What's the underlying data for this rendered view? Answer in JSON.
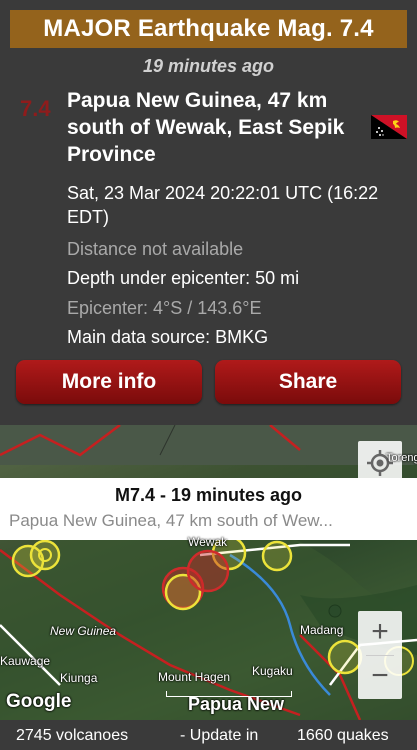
{
  "banner": {
    "title": "MAJOR Earthquake Mag. 7.4"
  },
  "time_ago": "19 minutes ago",
  "quake": {
    "magnitude": "7.4",
    "location": "Papua New Guinea, 47 km south of Wewak, East Sepik Province",
    "datetime": "Sat, 23 Mar 2024 20:22:01 UTC (16:22 EDT)",
    "distance": "Distance not available",
    "depth": "Depth under epicenter: 50 mi",
    "epicenter": "Epicenter: 4°S / 143.6°E",
    "source": "Main data source: BMKG"
  },
  "buttons": {
    "more_info": "More info",
    "share": "Share"
  },
  "map": {
    "popup_title": "M7.4  -  19 minutes ago",
    "popup_subtitle": "Papua New Guinea, 47 km south of Wew...",
    "labels": {
      "wewak": "Wewak",
      "new_guinea": "New Guinea",
      "madang": "Madang",
      "kiunga": "Kiunga",
      "kauwage": "Kauwage",
      "mount_hagen": "Mount Hagen",
      "kugaku": "Kugaku",
      "papua_new": "Papua New",
      "oreng": "Toreng"
    },
    "google": "Google",
    "zoom_in": "+",
    "zoom_out": "−"
  },
  "footer": {
    "volcanoes": "2745 volcanoes",
    "update": "- Update in",
    "quakes": "1660 quakes"
  },
  "colors": {
    "banner": "#94631c",
    "button": "#9a1414",
    "magnitude": "#8e1c1c"
  }
}
